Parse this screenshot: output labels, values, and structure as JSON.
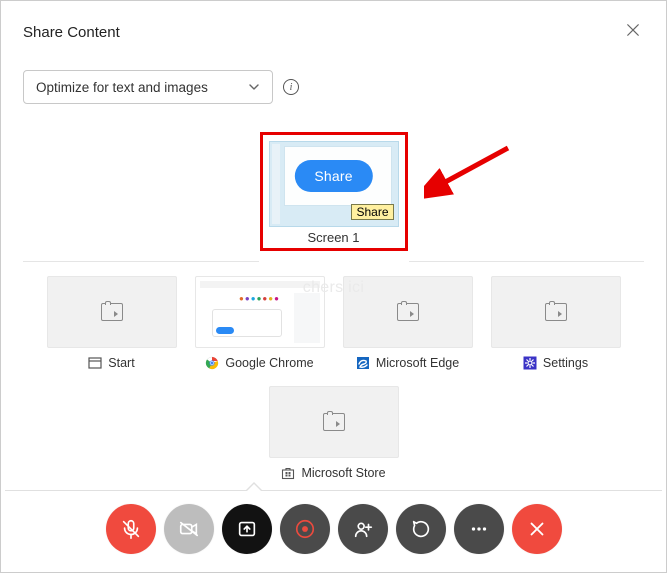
{
  "dialog": {
    "title": "Share Content",
    "dropdown_label": "Optimize for text and images"
  },
  "screen": {
    "share_btn": "Share",
    "tooltip": "Share",
    "caption": "Screen 1"
  },
  "apps": [
    {
      "label": "Start"
    },
    {
      "label": "Google Chrome"
    },
    {
      "label": "Microsoft Edge"
    },
    {
      "label": "Settings"
    },
    {
      "label": "Microsoft Store"
    }
  ],
  "watermark": "chers   ici"
}
